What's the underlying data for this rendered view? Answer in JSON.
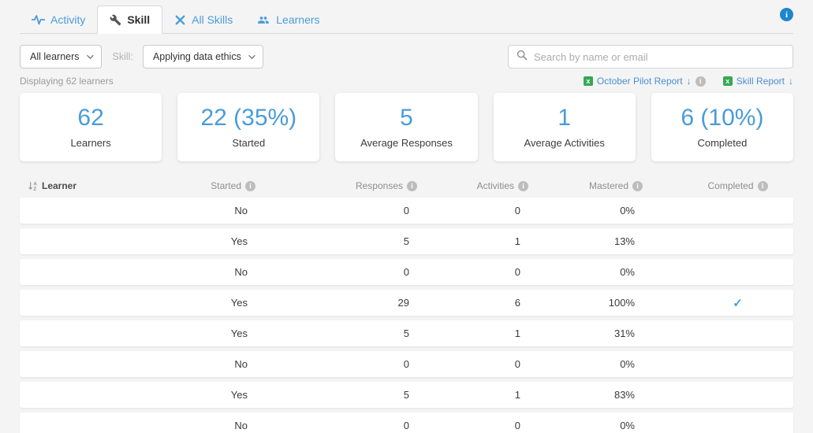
{
  "tabs": [
    {
      "label": "Activity",
      "active": false
    },
    {
      "label": "Skill",
      "active": true
    },
    {
      "label": "All Skills",
      "active": false
    },
    {
      "label": "Learners",
      "active": false
    }
  ],
  "filters": {
    "learners_dropdown": {
      "value": "All learners"
    },
    "skill_label": "Skill:",
    "skill_dropdown": {
      "value": "Applying data ethics"
    },
    "search": {
      "placeholder": "Search by name or email"
    }
  },
  "meta": {
    "displaying_text": "Displaying 62 learners",
    "reports": [
      {
        "label": "October Pilot Report",
        "has_info": true
      },
      {
        "label": "Skill Report",
        "has_info": false
      }
    ]
  },
  "stats": [
    {
      "value": "62",
      "label": "Learners"
    },
    {
      "value": "22 (35%)",
      "label": "Started"
    },
    {
      "value": "5",
      "label": "Average Responses"
    },
    {
      "value": "1",
      "label": "Average Activities"
    },
    {
      "value": "6 (10%)",
      "label": "Completed"
    }
  ],
  "table": {
    "columns": [
      "Learner",
      "Started",
      "Responses",
      "Activities",
      "Mastered",
      "Completed"
    ],
    "info_columns": [
      false,
      true,
      true,
      true,
      true,
      true
    ],
    "rows": [
      {
        "learner": "",
        "started": "No",
        "responses": "0",
        "activities": "0",
        "mastered": "0%",
        "completed": false
      },
      {
        "learner": "",
        "started": "Yes",
        "responses": "5",
        "activities": "1",
        "mastered": "13%",
        "completed": false
      },
      {
        "learner": "",
        "started": "No",
        "responses": "0",
        "activities": "0",
        "mastered": "0%",
        "completed": false
      },
      {
        "learner": "",
        "started": "Yes",
        "responses": "29",
        "activities": "6",
        "mastered": "100%",
        "completed": true
      },
      {
        "learner": "",
        "started": "Yes",
        "responses": "5",
        "activities": "1",
        "mastered": "31%",
        "completed": false
      },
      {
        "learner": "",
        "started": "No",
        "responses": "0",
        "activities": "0",
        "mastered": "0%",
        "completed": false
      },
      {
        "learner": "",
        "started": "Yes",
        "responses": "5",
        "activities": "1",
        "mastered": "83%",
        "completed": false
      },
      {
        "learner": "",
        "started": "No",
        "responses": "0",
        "activities": "0",
        "mastered": "0%",
        "completed": false
      }
    ]
  },
  "colors": {
    "accent_blue": "#4a9cd9",
    "link_blue": "#4a90d2",
    "excel_green": "#35a853",
    "check_blue": "#3fa2e0"
  }
}
